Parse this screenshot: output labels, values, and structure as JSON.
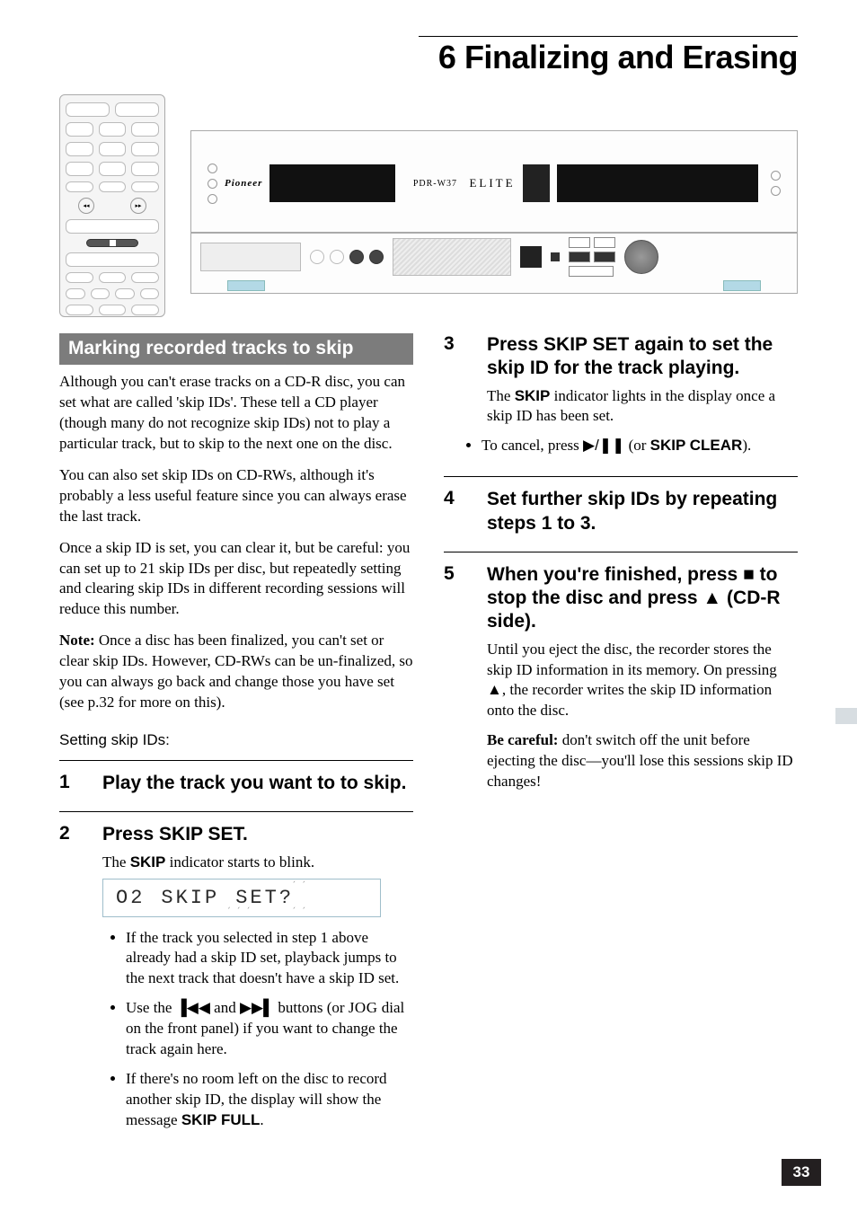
{
  "chapter": {
    "title": "6 Finalizing and Erasing"
  },
  "device": {
    "brand": "Pioneer",
    "model": "PDR-W37",
    "line": "ELITE"
  },
  "section": {
    "heading": "Marking recorded tracks to skip"
  },
  "intro": {
    "p1": "Although you can't erase tracks on a CD-R disc, you can set what are called 'skip IDs'. These tell a CD player (though many do not recognize skip IDs) not to play a particular track, but to skip to the next one on the disc.",
    "p2": "You can also set skip IDs on CD-RWs, although it's probably a less useful feature since you can always erase the last track.",
    "p3": "Once a skip ID is set, you can clear it, but be careful: you can set up to 21 skip IDs per disc, but repeatedly setting and clearing skip IDs in different recording sessions will reduce this number.",
    "note_label": "Note:",
    "note": " Once a disc has been finalized, you can't set or clear skip IDs. However, CD-RWs can be un-finalized, so you can always go back and change those you have set (see p.32 for more on this).",
    "setting_heading": "Setting skip IDs:"
  },
  "steps_left": {
    "s1": {
      "num": "1",
      "title": "Play the track you want to to skip."
    },
    "s2": {
      "num": "2",
      "title": "Press SKIP SET.",
      "desc_pre": "The ",
      "desc_label": "SKIP",
      "desc_post": " indicator starts to blink.",
      "bullets": [
        "If the track you selected in step 1 above already had a skip ID set, playback jumps to the next track that doesn't have a skip ID set.",
        null,
        null
      ],
      "b2_pre": "Use the ",
      "b2_mid": " and ",
      "b2_post": " buttons (or ",
      "b2_jog": "JOG",
      "b2_tail": " dial on the front panel) if you want to change the track again here.",
      "b3_pre": "If there's no room left on the disc to record another skip ID, the display will show the message ",
      "b3_label": "SKIP FULL",
      "b3_post": "."
    }
  },
  "lcd": {
    "track": "O2",
    "text": "SKIP",
    "flash": "SET?"
  },
  "steps_right": {
    "s3": {
      "num": "3",
      "title": "Press SKIP SET again to set the skip ID for the track playing.",
      "desc_pre": "The ",
      "desc_label": "SKIP",
      "desc_post": " indicator lights in the display once a skip ID has been set.",
      "bullet_pre": "To cancel, press ",
      "bullet_mid": " (or ",
      "bullet_label": "SKIP CLEAR",
      "bullet_post": ")."
    },
    "s4": {
      "num": "4",
      "title": "Set further skip IDs by repeating steps 1 to 3."
    },
    "s5": {
      "num": "5",
      "title_pre": "When you're finished, press ",
      "title_mid": " to stop the disc and press ",
      "title_post": " (CD-R side).",
      "desc_pre": "Until you eject the disc, the recorder stores the skip ID information in its memory. On pressing ",
      "desc_post": ", the recorder writes the skip ID information onto the disc.",
      "care_label": "Be careful:",
      "care": " don't switch off the unit before ejecting the disc—you'll lose this sessions skip ID changes!"
    }
  },
  "page_number": "33"
}
